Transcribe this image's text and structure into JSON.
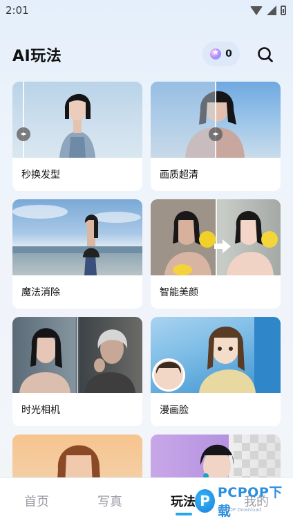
{
  "status_bar": {
    "time": "2:01"
  },
  "header": {
    "title": "AI玩法",
    "points": "0",
    "points_icon": "coin-star-icon",
    "search_icon": "search-icon"
  },
  "cards": [
    {
      "label": "秒换发型"
    },
    {
      "label": "画质超清"
    },
    {
      "label": "魔法消除"
    },
    {
      "label": "智能美颜"
    },
    {
      "label": "时光相机"
    },
    {
      "label": "漫画脸"
    }
  ],
  "bottom_nav": {
    "items": [
      {
        "label": "首页"
      },
      {
        "label": "写真"
      },
      {
        "label": "玩法"
      },
      {
        "label": "我的"
      }
    ],
    "active_index": 2
  },
  "watermark": {
    "logo_letter": "P",
    "text": "PCPOP下载",
    "sub": "PCPOP Download"
  },
  "colors": {
    "accent": "#29a7e8",
    "nav_inactive": "#9a9da3"
  }
}
